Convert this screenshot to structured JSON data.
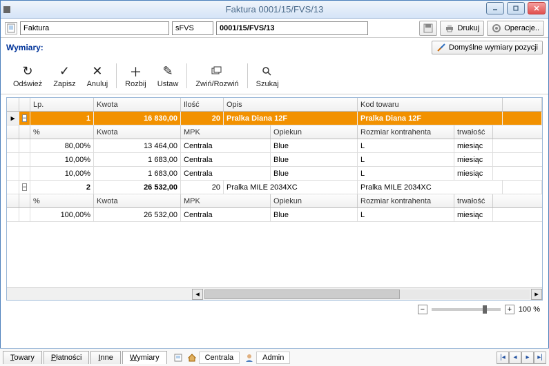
{
  "window": {
    "title": "Faktura 0001/15/FVS/13"
  },
  "topbar": {
    "doc_type": "Faktura",
    "prefix": "sFVS",
    "number": "0001/15/FVS/13",
    "print_label": "Drukuj",
    "ops_label": "Operacje.."
  },
  "section": {
    "title": "Wymiary:",
    "default_btn": "Domyślne wymiary pozycji"
  },
  "actions": {
    "refresh": "Odśwież",
    "save": "Zapisz",
    "cancel": "Anuluj",
    "split": "Rozbij",
    "set": "Ustaw",
    "collapse": "Zwiń/Rozwiń",
    "search": "Szukaj"
  },
  "grid": {
    "headers": {
      "lp": "Lp.",
      "kwota": "Kwota",
      "ilosc": "Ilość",
      "opis": "Opis",
      "kod": "Kod towaru"
    },
    "sub_headers": {
      "pct": "%",
      "kwota": "Kwota",
      "mpk": "MPK",
      "opiekun": "Opiekun",
      "rozmiar": "Rozmiar kontrahenta",
      "trwalosc": "trwałość"
    },
    "groups": [
      {
        "lp": "1",
        "kwota": "16 830,00",
        "ilosc": "20",
        "opis": "Pralka Diana 12F",
        "kod": "Pralka Diana 12F",
        "rows": [
          {
            "pct": "80,00%",
            "kwota": "13 464,00",
            "mpk": "Centrala",
            "opiekun": "Blue",
            "rozmiar": "L",
            "trw": "miesiąc"
          },
          {
            "pct": "10,00%",
            "kwota": "1 683,00",
            "mpk": "Centrala",
            "opiekun": "Blue",
            "rozmiar": "L",
            "trw": "miesiąc"
          },
          {
            "pct": "10,00%",
            "kwota": "1 683,00",
            "mpk": "Centrala",
            "opiekun": "Blue",
            "rozmiar": "L",
            "trw": "miesiąc"
          }
        ]
      },
      {
        "lp": "2",
        "kwota": "26 532,00",
        "ilosc": "20",
        "opis": "Pralka MILE 2034XC",
        "kod": "Pralka MILE 2034XC",
        "rows": [
          {
            "pct": "100,00%",
            "kwota": "26 532,00",
            "mpk": "Centrala",
            "opiekun": "Blue",
            "rozmiar": "L",
            "trw": "miesiąc"
          }
        ]
      }
    ]
  },
  "zoom": {
    "value": "100 %"
  },
  "tabs": {
    "towary": "Towary",
    "platnosci": "Płatności",
    "inne": "Inne",
    "wymiary": "Wymiary"
  },
  "status": {
    "loc": "Centrala",
    "user": "Admin"
  }
}
